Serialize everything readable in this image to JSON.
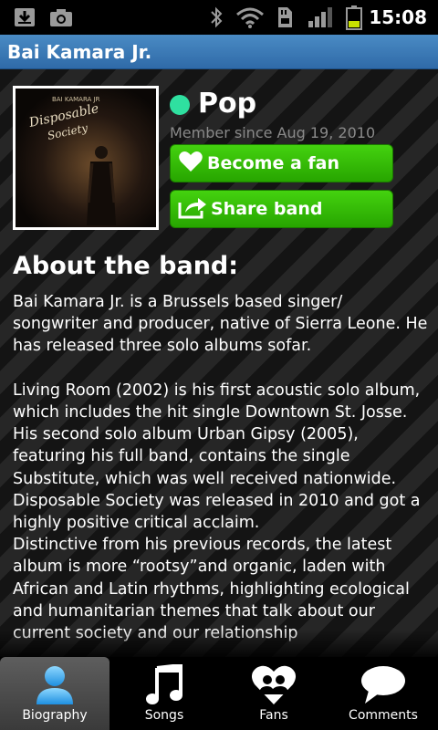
{
  "status_bar": {
    "time": "15:08",
    "icons": [
      "download-icon",
      "camera-icon",
      "bluetooth-icon",
      "wifi-icon",
      "sd-card-icon",
      "signal-icon",
      "battery-icon"
    ]
  },
  "title_bar": {
    "title": "Bai Kamara Jr."
  },
  "band": {
    "album_cover_icon": "album-cover",
    "genre": "Pop",
    "genre_color": "#2fe0a0",
    "member_since": "Member since Aug 19, 2010",
    "become_fan_label": "Become a fan",
    "share_label": "Share band",
    "button_color": "#3bc40a"
  },
  "about": {
    "heading": "About the band:",
    "text": "Bai Kamara Jr. is a Brussels based singer/ songwriter and producer, native of Sierra Leone. He has released three solo albums sofar.\n\nLiving Room (2002) is his first acoustic solo album, which includes the hit single Downtown St. Josse.\nHis second solo album Urban Gipsy (2005), featuring his full band, contains the single Substitute, which was well received nationwide.\nDisposable Society was released in 2010 and got a highly positive critical acclaim.\nDistinctive from his previous records, the latest album is more “rootsy”and organic, laden with African and Latin rhythms, highlighting ecological and humanitarian themes that talk about our current society and our relationship"
  },
  "tabs": [
    {
      "label": "Biography",
      "icon": "person-icon",
      "active": true
    },
    {
      "label": "Songs",
      "icon": "music-note-icon",
      "active": false
    },
    {
      "label": "Fans",
      "icon": "heart-people-icon",
      "active": false
    },
    {
      "label": "Comments",
      "icon": "speech-bubble-icon",
      "active": false
    }
  ]
}
